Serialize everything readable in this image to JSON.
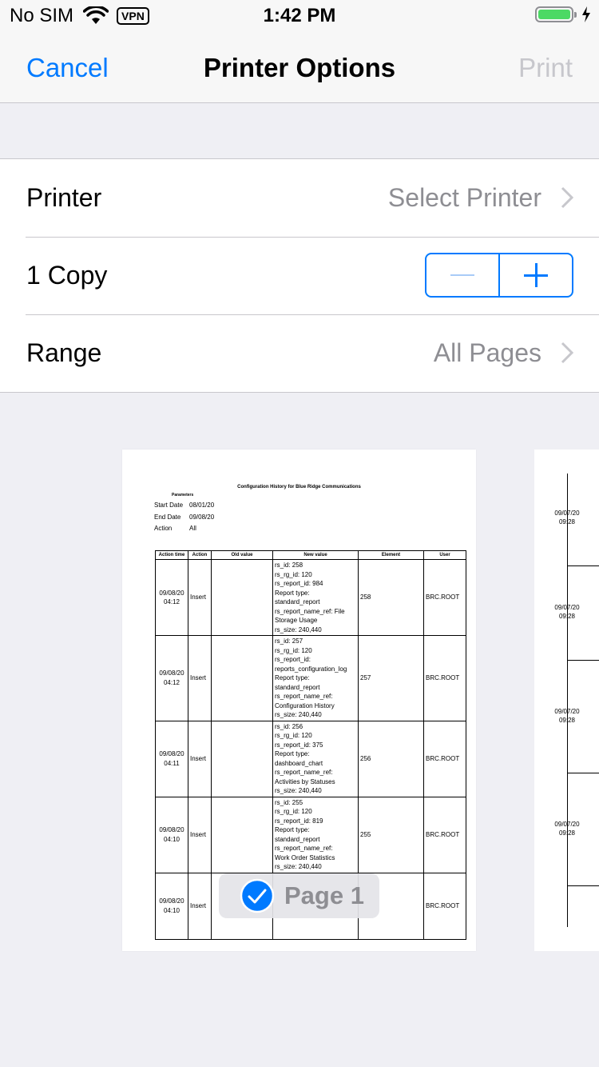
{
  "status_bar": {
    "carrier": "No SIM",
    "vpn": "VPN",
    "time": "1:42 PM",
    "battery_color": "#4cd964"
  },
  "nav": {
    "cancel": "Cancel",
    "title": "Printer Options",
    "print": "Print"
  },
  "options": {
    "printer_label": "Printer",
    "printer_value": "Select Printer",
    "copies_label": "1 Copy",
    "range_label": "Range",
    "range_value": "All Pages"
  },
  "preview": {
    "page_label": "Page 1",
    "doc": {
      "title": "Configuration History for Blue Ridge Communications",
      "params_heading": "Parameters",
      "meta": [
        {
          "key": "Start Date",
          "value": "08/01/20"
        },
        {
          "key": "End Date",
          "value": "09/08/20"
        },
        {
          "key": "Action",
          "value": "All"
        }
      ],
      "columns": [
        "Action time",
        "Action",
        "Old value",
        "New value",
        "Element",
        "User"
      ],
      "rows": [
        {
          "time": [
            "09/08/20",
            "04:12"
          ],
          "action": "Insert",
          "old": "",
          "new": [
            "rs_id: 258",
            "rs_rg_id: 120",
            "rs_report_id: 984",
            "Report type:",
            "standard_report",
            "rs_report_name_ref: File",
            "Storage Usage",
            "rs_size: 240,440"
          ],
          "element": "258",
          "user": "BRC.ROOT"
        },
        {
          "time": [
            "09/08/20",
            "04:12"
          ],
          "action": "Insert",
          "old": "",
          "new": [
            "rs_id: 257",
            "rs_rg_id: 120",
            "rs_report_id:",
            "reports_configuration_log",
            "Report type:",
            "standard_report",
            "rs_report_name_ref:",
            "Configuration History",
            "rs_size: 240,440"
          ],
          "element": "257",
          "user": "BRC.ROOT"
        },
        {
          "time": [
            "09/08/20",
            "04:11"
          ],
          "action": "Insert",
          "old": "",
          "new": [
            "rs_id: 256",
            "rs_rg_id: 120",
            "rs_report_id: 375",
            "Report type:",
            "dashboard_chart",
            "rs_report_name_ref:",
            "Activities by Statuses",
            "rs_size: 240,440"
          ],
          "element": "256",
          "user": "BRC.ROOT"
        },
        {
          "time": [
            "09/08/20",
            "04:10"
          ],
          "action": "Insert",
          "old": "",
          "new": [
            "rs_id: 255",
            "rs_rg_id: 120",
            "rs_report_id: 819",
            "Report type:",
            "standard_report",
            "rs_report_name_ref:",
            "Work Order Statistics",
            "rs_size: 240,440"
          ],
          "element": "255",
          "user": "BRC.ROOT"
        },
        {
          "time": [
            "09/08/20",
            "04:10"
          ],
          "action": "Insert",
          "old": "",
          "new": [
            "",
            "",
            "",
            "",
            "",
            "",
            ""
          ],
          "element": "",
          "user": "BRC.ROOT"
        }
      ]
    },
    "page2": {
      "dates": [
        [
          "09/07/20",
          "09:28"
        ],
        [
          "09/07/20",
          "09:28"
        ],
        [
          "09/07/20",
          "09:28"
        ],
        [
          "09/07/20",
          "09:28"
        ]
      ]
    }
  }
}
